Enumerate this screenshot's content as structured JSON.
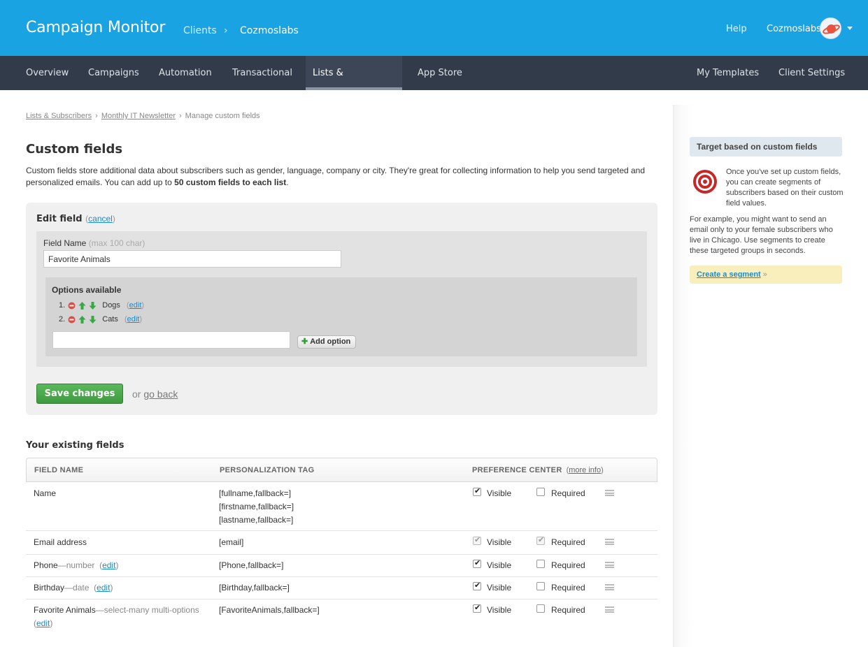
{
  "header": {
    "brand": "Campaign Monitor",
    "crumb_clients": "Clients",
    "crumb_sep": "›",
    "crumb_client": "Cozmoslabs",
    "help": "Help",
    "user": "Cozmoslabs"
  },
  "nav": {
    "left": [
      "Overview",
      "Campaigns",
      "Automation",
      "Transactional",
      "Lists & Subscribers",
      "App Store"
    ],
    "active": "Lists & Subscribers",
    "right": [
      "My Templates",
      "Client Settings"
    ]
  },
  "breadcrumb": {
    "items": [
      "Lists & Subscribers",
      "Monthly IT Newsletter"
    ],
    "current": "Manage custom fields",
    "sep": "›"
  },
  "page": {
    "title": "Custom fields",
    "intro_a": "Custom fields store additional data about subscribers such as gender, language, company or city. They're great for collecting information to help you send targeted and personalized emails. You can add up to ",
    "intro_b": "50 custom fields to each list",
    "intro_c": "."
  },
  "edit": {
    "title": "Edit field",
    "cancel": "cancel",
    "field_name_label": "Field Name",
    "field_name_hint": "(max 100 char)",
    "field_name_value": "Favorite Animals",
    "options_title": "Options available",
    "options": [
      {
        "num": "1.",
        "name": "Dogs",
        "edit": "edit"
      },
      {
        "num": "2.",
        "name": "Cats",
        "edit": "edit"
      }
    ],
    "new_option_value": "",
    "add_option": "Add option",
    "save": "Save changes",
    "or": "or",
    "go_back": "go back"
  },
  "existing": {
    "title": "Your existing fields",
    "col_name": "FIELD NAME",
    "col_tag": "PERSONALIZATION TAG",
    "col_pref": "PREFERENCE CENTER",
    "more_info": "more info",
    "visible_label": "Visible",
    "required_label": "Required",
    "rows": [
      {
        "name": "Name",
        "type": "",
        "edit": "",
        "tags": [
          "[fullname,fallback=]",
          "[firstname,fallback=]",
          "[lastname,fallback=]"
        ],
        "visible": true,
        "required": false
      },
      {
        "name": "Email address",
        "type": "",
        "edit": "",
        "tags": [
          "[email]"
        ],
        "visible": true,
        "required": true
      },
      {
        "name": "Phone",
        "type": "—number",
        "edit": "edit",
        "tags": [
          "[Phone,fallback=]"
        ],
        "visible": true,
        "required": false
      },
      {
        "name": "Birthday",
        "type": "—date",
        "edit": "edit",
        "tags": [
          "[Birthday,fallback=]"
        ],
        "visible": true,
        "required": false
      },
      {
        "name": "Favorite Animals",
        "type": "—select-many multi-options",
        "edit": "edit",
        "tags": [
          "[FavoriteAnimals,fallback=]"
        ],
        "visible": true,
        "required": false
      }
    ]
  },
  "sidebar": {
    "heading": "Target based on custom fields",
    "p1": "Once you've set up custom fields, you can create segments of subscribers based on their custom field values.",
    "p2": "For example, you might want to send an email only to your female subscribers who live in Chicago. Use segments to create these targeted groups in seconds.",
    "link": "Create a segment",
    "link_suffix": "»"
  },
  "colors": {
    "topbar": "#1aa3e2",
    "nav": "#323b4a",
    "save": "#4cae4c",
    "link": "#1a8ccd"
  }
}
